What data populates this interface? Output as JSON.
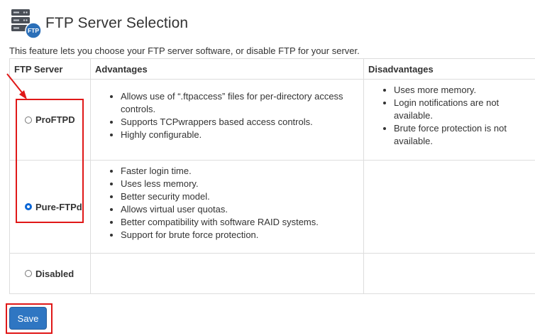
{
  "header": {
    "title": "FTP Server Selection",
    "icon": "ftp-server-icon",
    "icon_badge": "FTP",
    "description": "This feature lets you choose your FTP server software, or disable FTP for your server."
  },
  "table": {
    "headers": [
      "FTP Server",
      "Advantages",
      "Disadvantages"
    ],
    "rows": [
      {
        "label": "ProFTPD",
        "selected": false,
        "advantages": [
          "Allows use of “.ftpaccess” files for per-directory access controls.",
          "Supports TCPwrappers based access controls.",
          "Highly configurable."
        ],
        "disadvantages": [
          "Uses more memory.",
          "Login notifications are not available.",
          "Brute force protection is not available."
        ]
      },
      {
        "label": "Pure-FTPd",
        "selected": true,
        "advantages": [
          "Faster login time.",
          "Uses less memory.",
          "Better security model.",
          "Allows virtual user quotas.",
          "Better compatibility with software RAID systems.",
          "Support for brute force protection."
        ],
        "disadvantages": []
      },
      {
        "label": "Disabled",
        "selected": false,
        "advantages": [],
        "disadvantages": []
      }
    ]
  },
  "actions": {
    "save_label": "Save"
  },
  "colors": {
    "accent": "#2f76c2",
    "annotation": "#e01818",
    "radio_selected": "#0a66d6"
  }
}
